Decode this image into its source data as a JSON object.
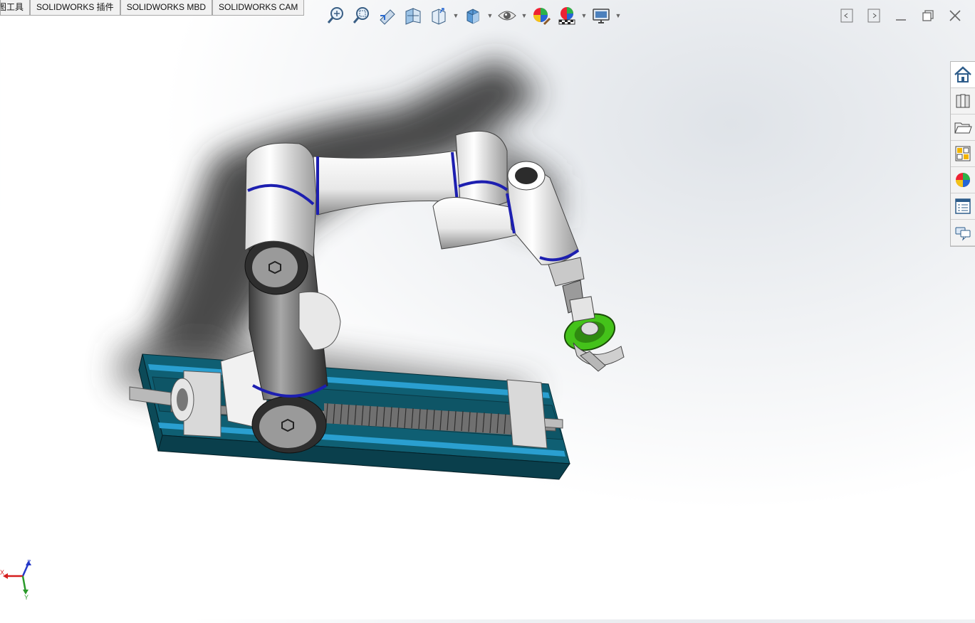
{
  "tabs": [
    {
      "label": "草图工具"
    },
    {
      "label": "SOLIDWORKS 插件"
    },
    {
      "label": "SOLIDWORKS MBD"
    },
    {
      "label": "SOLIDWORKS CAM"
    }
  ],
  "heads_up_toolbar": [
    {
      "icon": "zoom-to-fit-icon"
    },
    {
      "icon": "zoom-to-area-icon"
    },
    {
      "icon": "previous-view-icon"
    },
    {
      "icon": "section-view-icon"
    },
    {
      "icon": "view-orientation-icon"
    },
    {
      "icon": "display-style-icon"
    },
    {
      "icon": "hide-show-items-icon"
    },
    {
      "icon": "edit-appearance-icon"
    },
    {
      "icon": "apply-scene-icon"
    },
    {
      "icon": "view-settings-icon"
    }
  ],
  "window_controls": [
    "restore-left-icon",
    "restore-right-icon",
    "minimize-icon",
    "maximize-icon",
    "close-icon"
  ],
  "task_pane": [
    {
      "icon": "solidworks-resources-icon"
    },
    {
      "icon": "design-library-icon"
    },
    {
      "icon": "file-explorer-icon"
    },
    {
      "icon": "view-palette-icon"
    },
    {
      "icon": "appearances-scenes-icon"
    },
    {
      "icon": "custom-properties-icon"
    },
    {
      "icon": "solidworks-forum-icon"
    }
  ],
  "model": {
    "description_icon": "robot-arm-on-linear-rail",
    "colors": {
      "rail": "#0f5f73",
      "rail_dark": "#0a3f4c",
      "rail_accent": "#2a9fd0",
      "arm_white": "#f4f4f4",
      "arm_gray": "#8a8a8a",
      "ring_blue": "#1d1fb0",
      "gripper_green": "#44c21a"
    }
  },
  "triad": {
    "z_label": "Z",
    "x_label": "X",
    "y_label": "Y",
    "colors": {
      "x": "#d51e1e",
      "y": "#2a9a2a",
      "z": "#2438c8"
    }
  }
}
